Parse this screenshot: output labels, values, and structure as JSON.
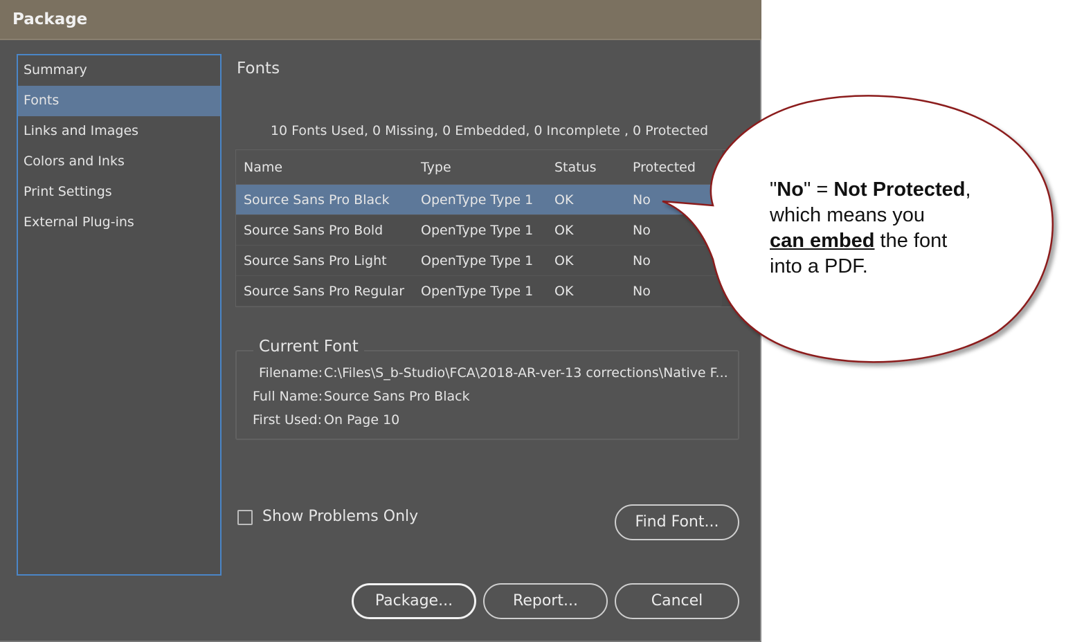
{
  "window": {
    "title": "Package"
  },
  "sidebar": {
    "items": [
      {
        "label": "Summary",
        "selected": false
      },
      {
        "label": "Fonts",
        "selected": true
      },
      {
        "label": "Links and Images",
        "selected": false
      },
      {
        "label": "Colors and Inks",
        "selected": false
      },
      {
        "label": "Print Settings",
        "selected": false
      },
      {
        "label": "External Plug-ins",
        "selected": false
      }
    ]
  },
  "main": {
    "section_title": "Fonts",
    "summary": "10 Fonts Used, 0 Missing, 0 Embedded, 0 Incomplete , 0 Protected",
    "table": {
      "headers": {
        "name": "Name",
        "type": "Type",
        "status": "Status",
        "protected": "Protected"
      },
      "rows": [
        {
          "name": "Source Sans Pro Black",
          "type": "OpenType Type 1",
          "status": "OK",
          "protected": "No",
          "selected": true
        },
        {
          "name": "Source Sans Pro Bold",
          "type": "OpenType Type 1",
          "status": "OK",
          "protected": "No",
          "selected": false
        },
        {
          "name": "Source Sans Pro Light",
          "type": "OpenType Type 1",
          "status": "OK",
          "protected": "No",
          "selected": false
        },
        {
          "name": "Source Sans Pro Regular",
          "type": "OpenType Type 1",
          "status": "OK",
          "protected": "No",
          "selected": false
        }
      ]
    },
    "current_font": {
      "legend": "Current Font",
      "filename_label": "Filename:",
      "filename_value": "C:\\Files\\S_b-Studio\\FCA\\2018-AR-ver-13 corrections\\Native F...",
      "fullname_label": "Full Name:",
      "fullname_value": "Source Sans Pro Black",
      "firstused_label": "First Used:",
      "firstused_value": "On Page 10"
    },
    "show_problems_only": {
      "label": "Show Problems Only",
      "checked": false
    },
    "find_font_label": "Find Font..."
  },
  "footer": {
    "package_label": "Package...",
    "report_label": "Report...",
    "cancel_label": "Cancel"
  },
  "callout": {
    "part1": "\"",
    "part2": "No",
    "part3": "\" = ",
    "part4": "Not Protected",
    "part5": ",",
    "line2": "which means you",
    "line3_emph": "can embed",
    "line3_rest": " the font",
    "line4": "into a PDF.",
    "border_color": "#8b1a1a"
  },
  "colors": {
    "dialog_bg": "#535353",
    "titlebar_bg": "#7b7160",
    "selection": "#5d7899",
    "sidebar_border": "#4a86c8"
  }
}
